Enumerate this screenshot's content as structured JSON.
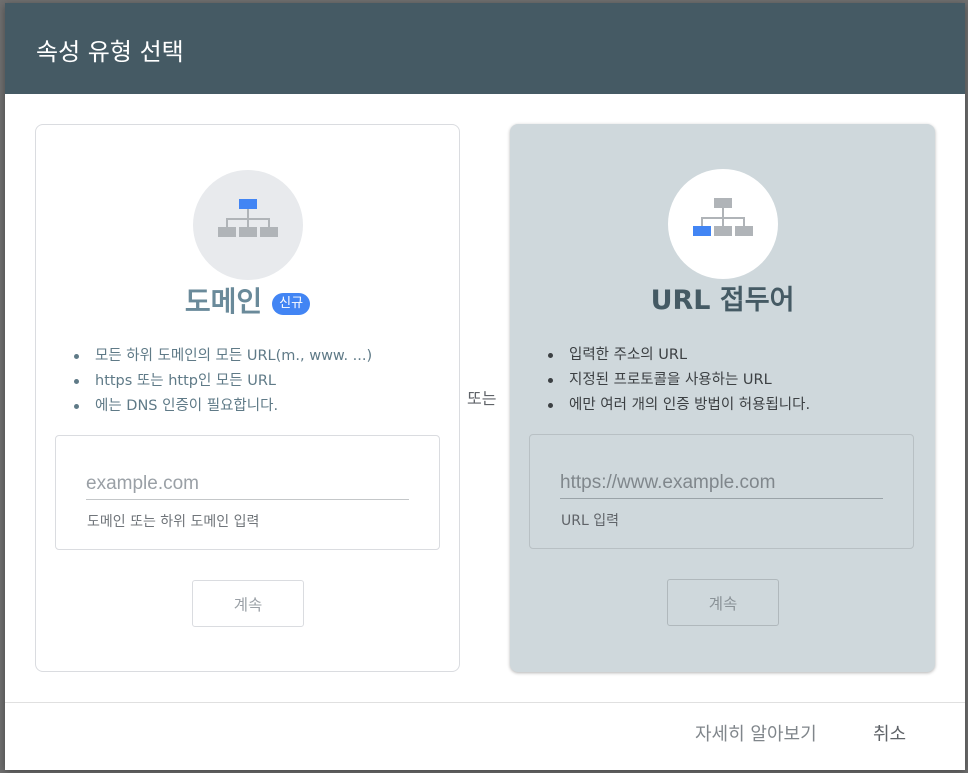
{
  "dialog": {
    "title": "속성 유형 선택",
    "or_label": "또는"
  },
  "domain_card": {
    "icon": "sitemap-top-highlight-icon",
    "title": "도메인",
    "badge": "신규",
    "bullets": [
      "모든 하위 도메인의 모든 URL(m., www. ...)",
      "https 또는 http인 모든 URL",
      "에는 DNS 인증이 필요합니다."
    ],
    "input_placeholder": "example.com",
    "input_hint": "도메인 또는 하위 도메인 입력",
    "continue_label": "계속"
  },
  "url_card": {
    "icon": "sitemap-bottom-left-highlight-icon",
    "title": "URL 접두어",
    "bullets": [
      "입력한 주소의 URL",
      "지정된 프로토콜을 사용하는 URL",
      "에만 여러 개의 인증 방법이 허용됩니다."
    ],
    "input_placeholder": "https://www.example.com",
    "input_hint": "URL 입력",
    "continue_label": "계속"
  },
  "footer": {
    "learn_more_label": "자세히 알아보기",
    "cancel_label": "취소"
  },
  "colors": {
    "header_bg": "#455a64",
    "highlight_blue": "#4285f4",
    "selected_card_bg": "#cfd8dc",
    "icon_gray": "#b0b4b8"
  }
}
